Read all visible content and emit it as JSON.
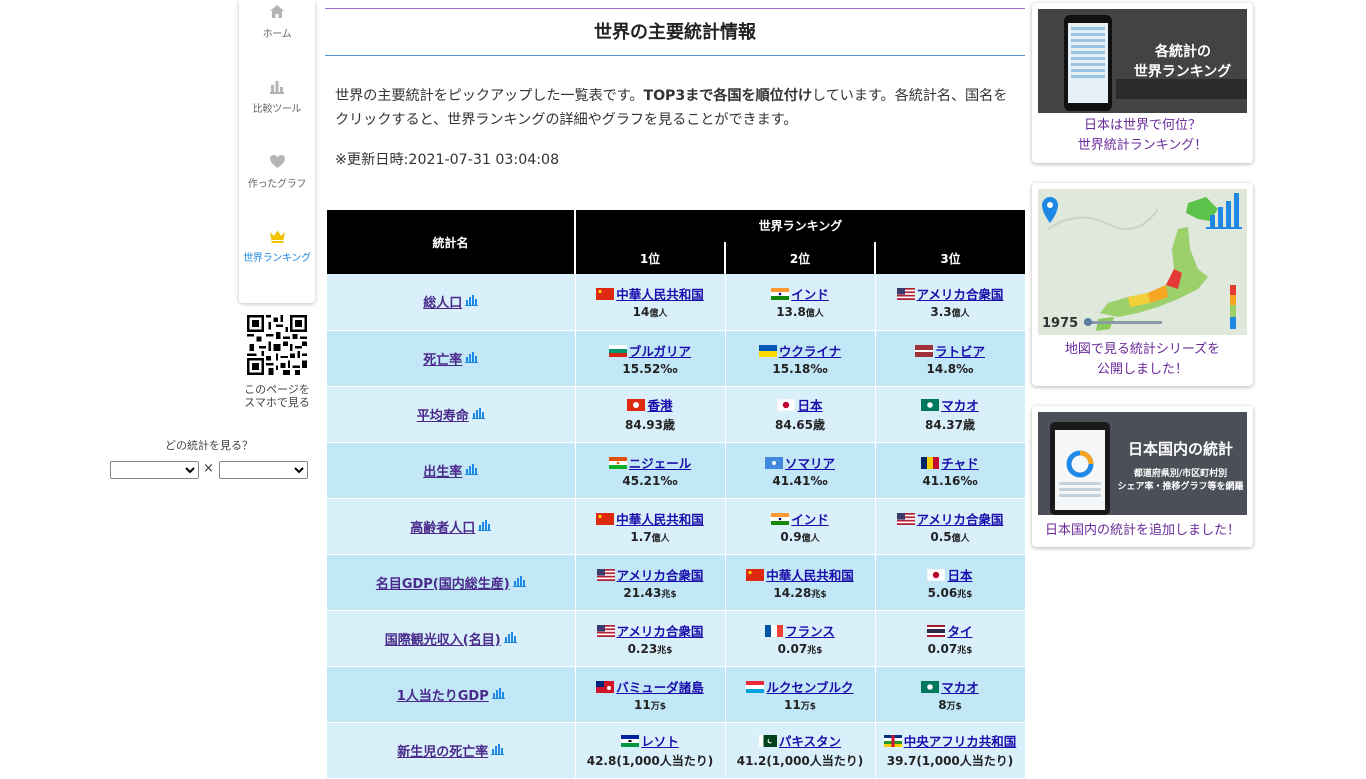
{
  "nav": {
    "items": [
      {
        "label": "ホーム",
        "icon": "home-icon"
      },
      {
        "label": "比較ツール",
        "icon": "bar-chart-icon"
      },
      {
        "label": "作ったグラフ",
        "icon": "heart-icon"
      },
      {
        "label": "世界ランキング",
        "icon": "crown-icon",
        "active": true
      }
    ]
  },
  "qr": {
    "caption_line1": "このページを",
    "caption_line2": "スマホで見る"
  },
  "stat_picker": {
    "title": "どの統計を見る？",
    "separator": "×",
    "select_a": "",
    "select_b": ""
  },
  "main": {
    "title": "世界の主要統計情報",
    "intro_pre": "世界の主要統計をピックアップした一覧表です。",
    "intro_bold": "TOP3まで各国を順位付け",
    "intro_post": "しています。各統計名、国名をクリックすると、世界ランキングの詳細やグラフを見ることができます。",
    "updated": "※更新日時:2021-07-31 03:04:08"
  },
  "table": {
    "header_name": "統計名",
    "header_ranking": "世界ランキング",
    "rank_labels": [
      "1位",
      "2位",
      "3位"
    ],
    "rows": [
      {
        "name": "総人口",
        "ranks": [
          {
            "country": "中華人民共和国",
            "flag": "cn",
            "value": "14",
            "unit": "億人"
          },
          {
            "country": "インド",
            "flag": "in",
            "value": "13.8",
            "unit": "億人"
          },
          {
            "country": "アメリカ合衆国",
            "flag": "us",
            "value": "3.3",
            "unit": "億人"
          }
        ]
      },
      {
        "name": "死亡率",
        "ranks": [
          {
            "country": "ブルガリア",
            "flag": "bg",
            "value": "15.52‰",
            "unit": ""
          },
          {
            "country": "ウクライナ",
            "flag": "ua",
            "value": "15.18‰",
            "unit": ""
          },
          {
            "country": "ラトビア",
            "flag": "lv",
            "value": "14.8‰",
            "unit": ""
          }
        ]
      },
      {
        "name": "平均寿命",
        "ranks": [
          {
            "country": "香港",
            "flag": "hk",
            "value": "84.93歳",
            "unit": ""
          },
          {
            "country": "日本",
            "flag": "jp",
            "value": "84.65歳",
            "unit": ""
          },
          {
            "country": "マカオ",
            "flag": "mo",
            "value": "84.37歳",
            "unit": ""
          }
        ]
      },
      {
        "name": "出生率",
        "ranks": [
          {
            "country": "ニジェール",
            "flag": "ne",
            "value": "45.21‰",
            "unit": ""
          },
          {
            "country": "ソマリア",
            "flag": "so",
            "value": "41.41‰",
            "unit": ""
          },
          {
            "country": "チャド",
            "flag": "td",
            "value": "41.16‰",
            "unit": ""
          }
        ]
      },
      {
        "name": "高齢者人口",
        "ranks": [
          {
            "country": "中華人民共和国",
            "flag": "cn",
            "value": "1.7",
            "unit": "億人"
          },
          {
            "country": "インド",
            "flag": "in",
            "value": "0.9",
            "unit": "億人"
          },
          {
            "country": "アメリカ合衆国",
            "flag": "us",
            "value": "0.5",
            "unit": "億人"
          }
        ]
      },
      {
        "name": "名目GDP(国内総生産)",
        "ranks": [
          {
            "country": "アメリカ合衆国",
            "flag": "us",
            "value": "21.43",
            "unit": "兆$"
          },
          {
            "country": "中華人民共和国",
            "flag": "cn",
            "value": "14.28",
            "unit": "兆$"
          },
          {
            "country": "日本",
            "flag": "jp",
            "value": "5.06",
            "unit": "兆$"
          }
        ]
      },
      {
        "name": "国際観光収入(名目)",
        "ranks": [
          {
            "country": "アメリカ合衆国",
            "flag": "us",
            "value": "0.23",
            "unit": "兆$"
          },
          {
            "country": "フランス",
            "flag": "fr",
            "value": "0.07",
            "unit": "兆$"
          },
          {
            "country": "タイ",
            "flag": "th",
            "value": "0.07",
            "unit": "兆$"
          }
        ]
      },
      {
        "name": "1人当たりGDP",
        "ranks": [
          {
            "country": "バミューダ諸島",
            "flag": "bm",
            "value": "11",
            "unit": "万$"
          },
          {
            "country": "ルクセンブルク",
            "flag": "lu",
            "value": "11",
            "unit": "万$"
          },
          {
            "country": "マカオ",
            "flag": "mo",
            "value": "8",
            "unit": "万$"
          }
        ]
      },
      {
        "name": "新生児の死亡率",
        "ranks": [
          {
            "country": "レソト",
            "flag": "ls",
            "value": "42.8(1,000人当たり)",
            "unit": ""
          },
          {
            "country": "パキスタン",
            "flag": "pk",
            "value": "41.2(1,000人当たり)",
            "unit": ""
          },
          {
            "country": "中央アフリカ共和国",
            "flag": "cf",
            "value": "39.7(1,000人当たり)",
            "unit": ""
          }
        ]
      }
    ]
  },
  "ads": [
    {
      "image_text_line1": "各統計の",
      "image_text_line2": "世界ランキング",
      "caption_line1": "日本は世界で何位？",
      "caption_line2": "世界統計ランキング！"
    },
    {
      "image_text_year": "1975",
      "caption_line1": "地図で見る統計シリーズを",
      "caption_line2": "公開しました！"
    },
    {
      "image_text_title": "日本国内の統計",
      "image_text_sub1": "都道府県別/市区町村別",
      "image_text_sub2": "シェア率・推移グラフ等を網羅",
      "caption_line1": "日本国内の統計を追加しました！"
    }
  ]
}
